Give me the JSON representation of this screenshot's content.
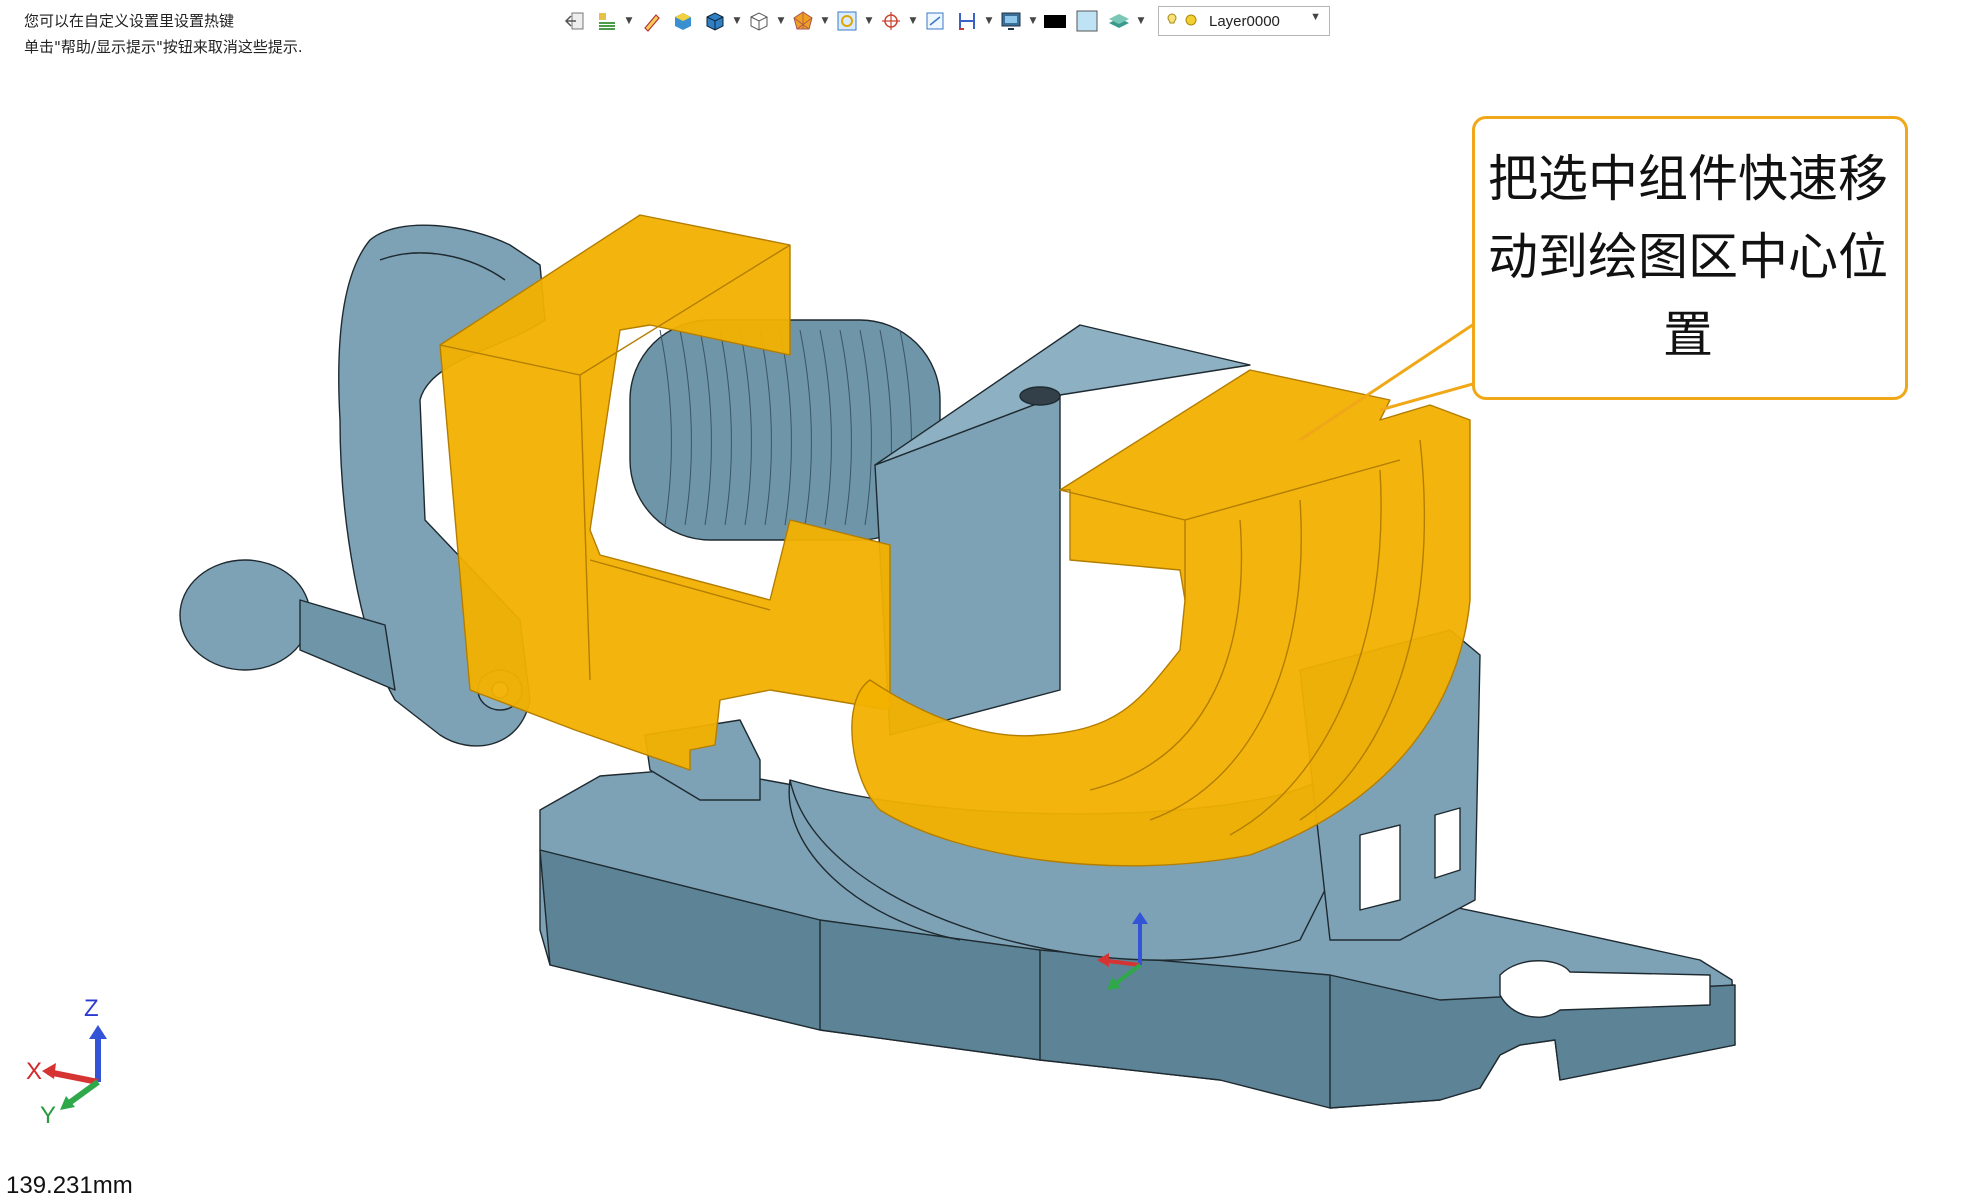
{
  "hints": {
    "line1": "您可以在自定义设置里设置热键",
    "line2": "单击\"帮助/显示提示\"按钮来取消这些提示."
  },
  "toolbar": {
    "icons": [
      "exit-sketch-icon",
      "layer-manager-icon",
      "pen-icon",
      "shaded-icon",
      "shaded-edges-icon",
      "wireframe-icon",
      "render-mode-icon",
      "zoom-fit-icon",
      "view-center-icon",
      "section-view-icon",
      "measure-icon",
      "display-icon",
      "color-swatch-icon",
      "fill-color-icon",
      "layer-style-icon"
    ],
    "layer": "Layer0000"
  },
  "callout": {
    "line1": "把选中组件快速移",
    "line2": "动到绘图区中心位",
    "line3": "置"
  },
  "measure": "139.231mm",
  "axes": {
    "x": "X",
    "y": "Y",
    "z": "Z"
  },
  "colors": {
    "part_blue": "#7ea2b5",
    "part_blue_dark": "#5d8396",
    "selection_orange": "#f2b100",
    "callout_border": "#f0a818"
  }
}
